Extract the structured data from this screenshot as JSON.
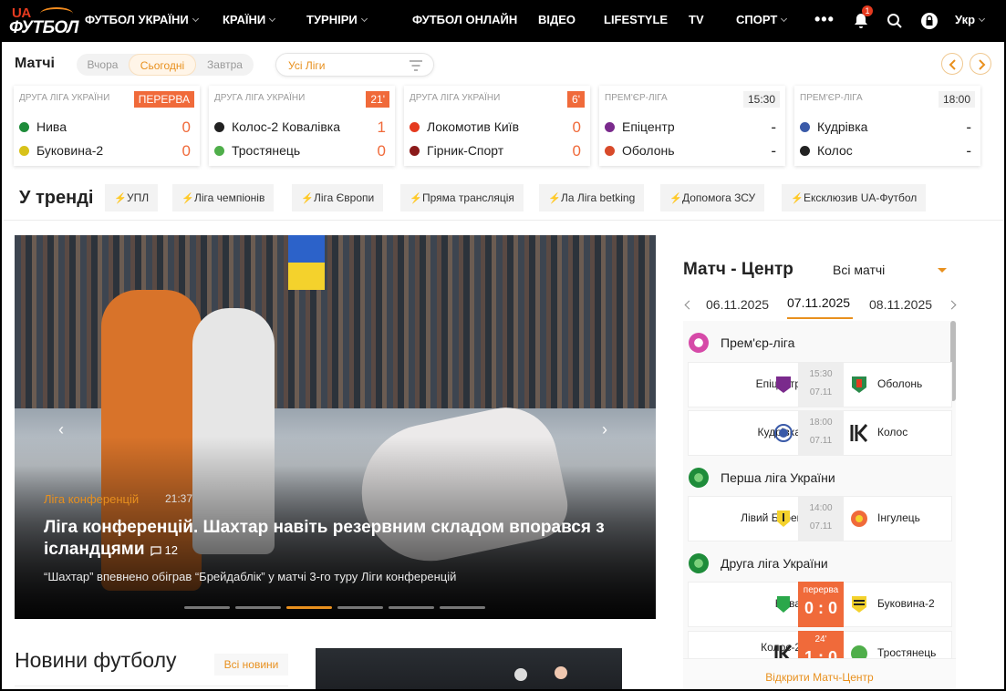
{
  "nav": {
    "logo_top": "UA",
    "logo_bottom": "ФУТБОЛ",
    "items": [
      "ФУТБОЛ УКРАЇНИ",
      "КРАЇНИ",
      "ТУРНІРИ",
      "ФУТБОЛ ОНЛАЙН",
      "ВІДЕО",
      "LIFESTYLE",
      "TV",
      "СПОРТ"
    ],
    "notifications": "1",
    "language": "Укр"
  },
  "matches": {
    "title": "Матчі",
    "day_tabs": [
      "Вчора",
      "Сьогодні",
      "Завтра"
    ],
    "league_filter": "Усі Ліги",
    "cards": [
      {
        "league": "ДРУГА ЛІГА УКРАЇНИ",
        "status": "ПЕРЕРВА",
        "home": "Нива",
        "away": "Буковина-2",
        "home_score": "0",
        "away_score": "0"
      },
      {
        "league": "ДРУГА ЛІГА УКРАЇНИ",
        "status": "21'",
        "home": "Колос-2 Ковалівка",
        "away": "Тростянець",
        "home_score": "1",
        "away_score": "0"
      },
      {
        "league": "ДРУГА ЛІГА УКРАЇНИ",
        "status": "6'",
        "home": "Локомотив Київ",
        "away": "Гірник-Спорт",
        "home_score": "0",
        "away_score": "0"
      },
      {
        "league": "ПРЕМ'ЄР-ЛІГА",
        "status": "15:30",
        "home": "Епіцентр",
        "away": "Оболонь",
        "home_score": "-",
        "away_score": "-"
      },
      {
        "league": "ПРЕМ'ЄР-ЛІГА",
        "status": "18:00",
        "home": "Кудрівка",
        "away": "Колос",
        "home_score": "-",
        "away_score": "-"
      }
    ]
  },
  "trends": {
    "title": "У тренді",
    "chips": [
      "УПЛ",
      "Ліга чемпіонів",
      "Ліга Європи",
      "Пряма трансляція",
      "Ла Ліга betking",
      "Допомога ЗСУ",
      "Ексклюзив UA-Футбол"
    ]
  },
  "hero": {
    "category": "Ліга конференцій",
    "time": "21:37",
    "title": "Ліга конференцій. Шахтар навіть резервним складом впорався з ісландцями",
    "comments": "12",
    "subtitle": "“Шахтар” впевнено обіграв “Брейдаблік” у матчі 3-го туру Ліги конференцій",
    "slides": 6,
    "active_slide": 3
  },
  "news": {
    "title": "Новини футболу",
    "all_label": "Всі новини"
  },
  "match_center": {
    "title": "Матч - Центр",
    "select": "Всі матчі",
    "dates": [
      "06.11.2025",
      "07.11.2025",
      "08.11.2025"
    ],
    "active_date": "07.11.2025",
    "leagues": [
      {
        "name": "Прем'єр-ліга",
        "matches": [
          {
            "home": "Епіцентр",
            "away": "Оболонь",
            "time": "15:30",
            "date": "07.11"
          },
          {
            "home": "Кудрівка",
            "away": "Колос",
            "time": "18:00",
            "date": "07.11"
          }
        ]
      },
      {
        "name": "Перша ліга України",
        "matches": [
          {
            "home": "Лівий Берег",
            "away": "Інгулець",
            "time": "14:00",
            "date": "07.11"
          }
        ]
      },
      {
        "name": "Друга ліга України",
        "matches": [
          {
            "home": "Нива",
            "away": "Буковина-2",
            "status": "перерва",
            "score": "0 : 0"
          },
          {
            "home": "Колос-2",
            "away": "Тростянець",
            "status": "24'",
            "score": "1 : 0"
          }
        ]
      }
    ],
    "open_label": "Відкрити Матч-Центр"
  }
}
